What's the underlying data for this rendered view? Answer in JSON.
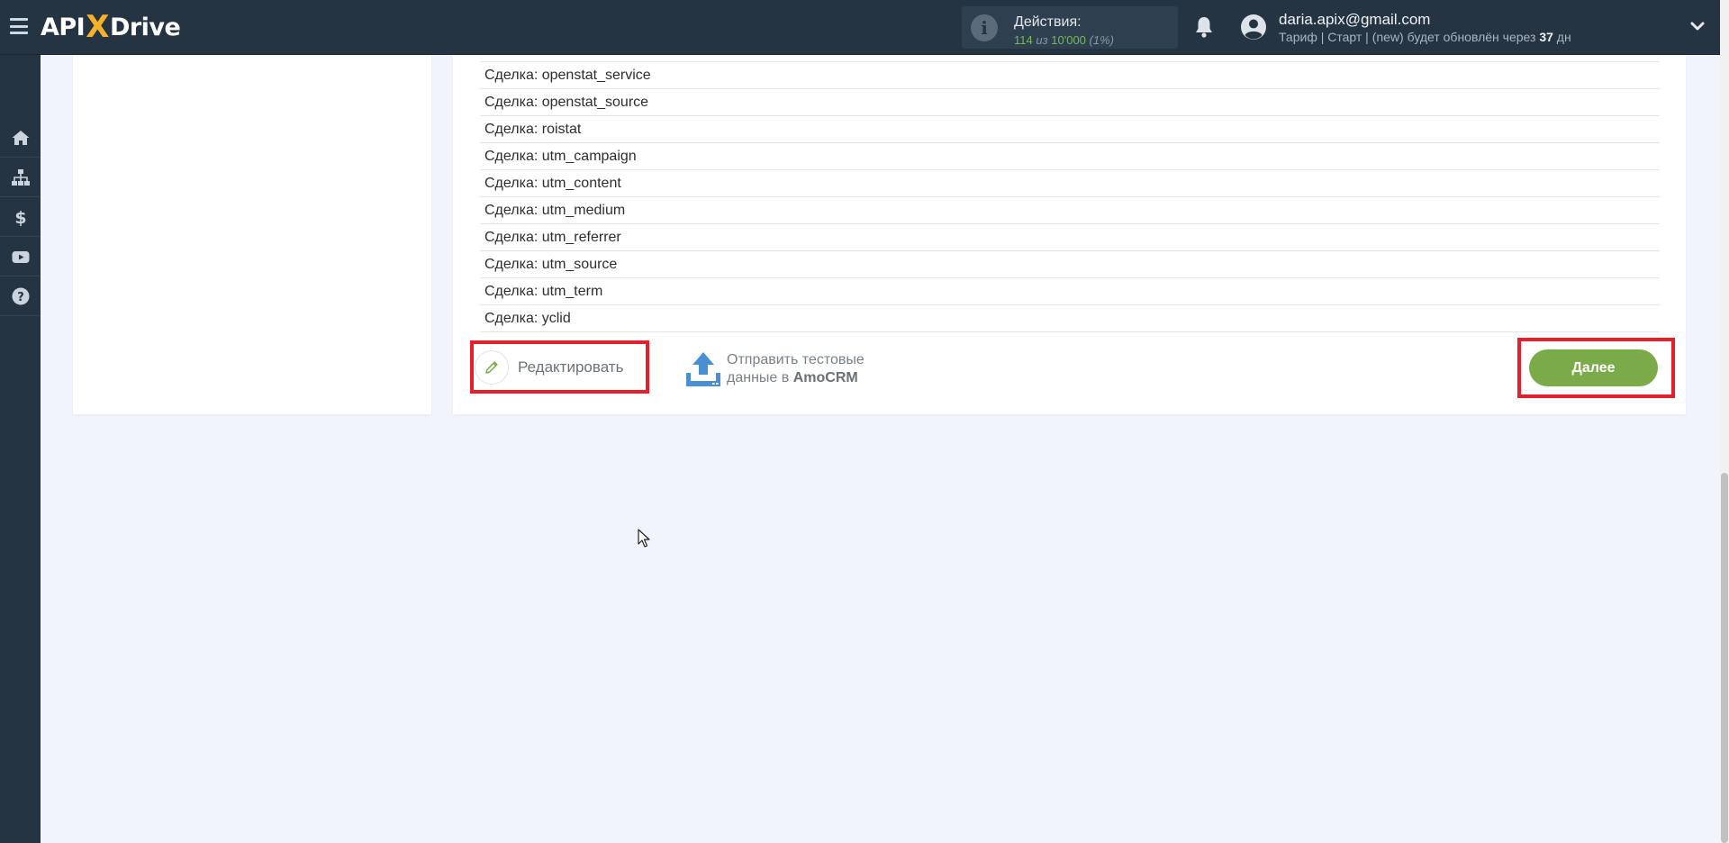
{
  "brand": {
    "logo_pre": "API",
    "logo_x": "X",
    "logo_post": "Drive"
  },
  "header": {
    "actions_label": "Действия:",
    "actions_used": "114",
    "actions_of": "из",
    "actions_total": "10'000",
    "actions_percent": "(1%)",
    "user_email": "daria.apix@gmail.com",
    "plan_text": "Тариф | Старт | (new) будет обновлён через",
    "plan_days": "37",
    "plan_days_unit": "дн"
  },
  "sidebar": {
    "items": [
      {
        "icon": "home-icon"
      },
      {
        "icon": "sitemap-icon"
      },
      {
        "icon": "dollar-icon"
      },
      {
        "icon": "youtube-icon"
      },
      {
        "icon": "help-icon"
      }
    ]
  },
  "fields": {
    "rows": [
      "Сделка: openstat_service",
      "Сделка: openstat_source",
      "Сделка: roistat",
      "Сделка: utm_campaign",
      "Сделка: utm_content",
      "Сделка: utm_medium",
      "Сделка: utm_referrer",
      "Сделка: utm_source",
      "Сделка: utm_term",
      "Сделка: yclid"
    ]
  },
  "buttons": {
    "edit_label": "Редактировать",
    "send_line1": "Отправить тестовые",
    "send_line2_pre": "данные в",
    "send_line2_brand": "AmoCRM",
    "next_label": "Далее"
  },
  "colors": {
    "topbar": "#243442",
    "accent_green": "#7bab49",
    "highlight_red": "#e3202c",
    "upload_blue": "#4a8fd4"
  }
}
